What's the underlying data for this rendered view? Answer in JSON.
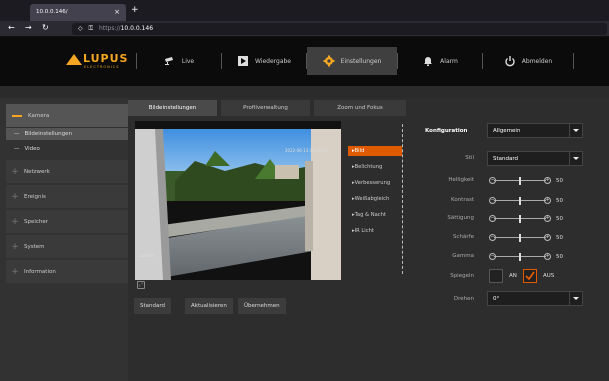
{
  "browser": {
    "tab_title": "10.0.0.146/",
    "tab_close": "×",
    "new_tab": "+",
    "url_proto": "https://",
    "url_host": "10.0.0.146"
  },
  "brand": {
    "name": "LUPUS",
    "sub": "ELECTRONICS"
  },
  "menu": [
    {
      "label": "Live",
      "icon": "camera-icon"
    },
    {
      "label": "Wiedergabe",
      "icon": "play-icon"
    },
    {
      "label": "Einstellungen",
      "icon": "gear-icon",
      "active": true
    },
    {
      "label": "Alarm",
      "icon": "bell-icon"
    },
    {
      "label": "Abmelden",
      "icon": "power-icon"
    }
  ],
  "sidebar": {
    "items": [
      {
        "label": "Kamera",
        "active": true
      },
      {
        "label": "Netzwerk"
      },
      {
        "label": "Ereignis"
      },
      {
        "label": "Speicher"
      },
      {
        "label": "System"
      },
      {
        "label": "Information"
      }
    ],
    "subitems": [
      {
        "label": "Bildeinstellungen",
        "active": true
      },
      {
        "label": "Video"
      }
    ]
  },
  "tabs": [
    "Bildeinstellungen",
    "Profilverwaltung",
    "Zoom und Fokus"
  ],
  "video": {
    "timestamp": "2022-06-13 09:12:52",
    "camera_name": "Camera"
  },
  "categories": [
    "Bild",
    "Belichtung",
    "Verbesserung",
    "Weißabgleich",
    "Tag & Nacht",
    "IR Licht"
  ],
  "buttons": {
    "standard": "Standard",
    "refresh": "Aktualisieren",
    "apply": "Übernehmen"
  },
  "settings": {
    "konfiguration_label": "Konfiguration",
    "konfiguration_value": "Allgemein",
    "stil_label": "Stil",
    "stil_value": "Standard",
    "sliders": [
      {
        "label": "Helligkeit",
        "value": "50",
        "level": 0.5
      },
      {
        "label": "Kontrast",
        "value": "50",
        "level": 0.5
      },
      {
        "label": "Sättigung",
        "value": "50",
        "level": 0.5
      },
      {
        "label": "Schärfe",
        "value": "50",
        "level": 0.5
      },
      {
        "label": "Gamma",
        "value": "50",
        "level": 0.5
      }
    ],
    "spiegeln_label": "Spiegeln",
    "spiegeln_on": "AN",
    "spiegeln_off": "AUS",
    "drehen_label": "Drehen",
    "drehen_value": "0°"
  },
  "colors": {
    "accent": "#f5a623",
    "active_orange": "#e05a00"
  }
}
